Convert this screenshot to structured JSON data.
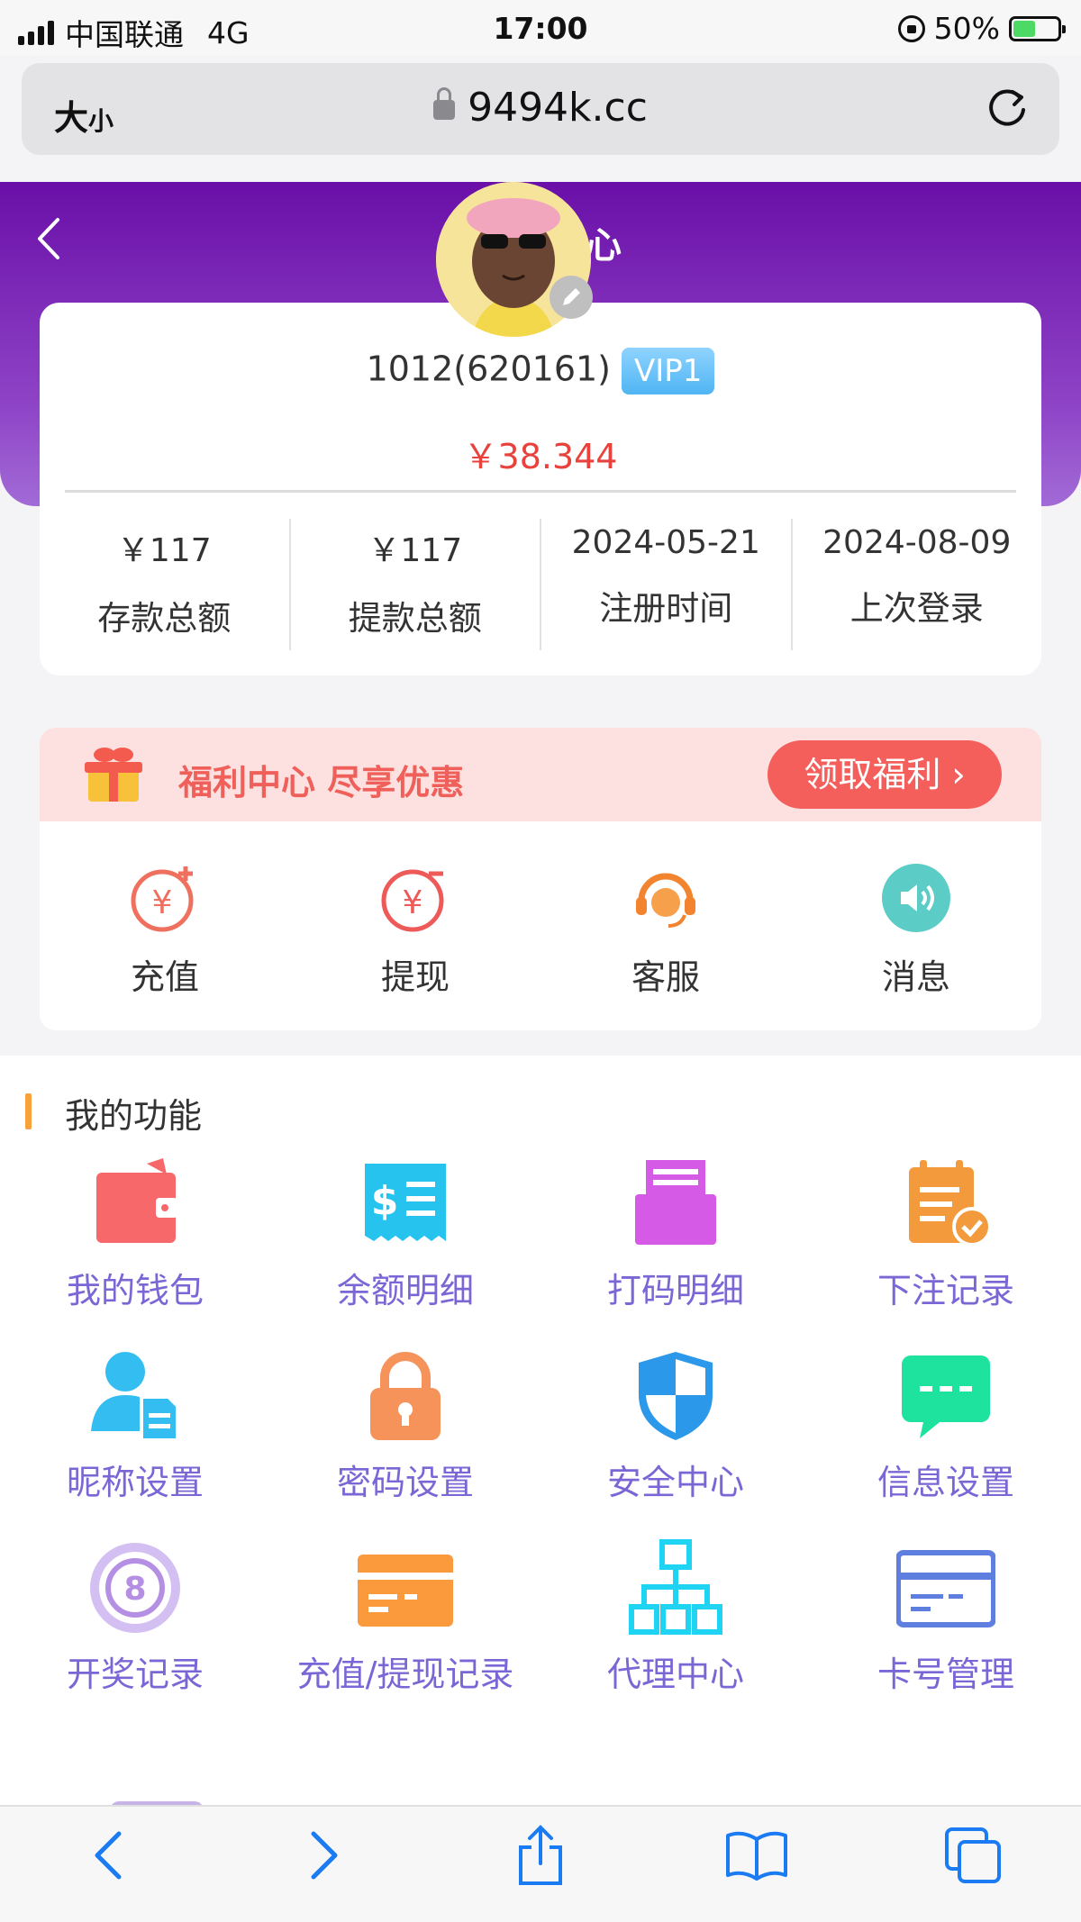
{
  "status_bar": {
    "carrier": "中国联通",
    "network": "4G",
    "time": "17:00",
    "battery": "50%"
  },
  "browser": {
    "text_size": "大",
    "text_size_small": "小",
    "url": "9494k.cc"
  },
  "header": {
    "title_fragment": "心"
  },
  "profile": {
    "username": "1012(620161)",
    "vip": "VIP1",
    "balance": "￥38.344"
  },
  "stats": [
    {
      "value": "￥117",
      "label": "存款总额"
    },
    {
      "value": "￥117",
      "label": "提款总额"
    },
    {
      "value": "2024-05-21",
      "label": "注册时间"
    },
    {
      "value": "2024-08-09",
      "label": "上次登录"
    }
  ],
  "welfare": {
    "text": "福利中心 尽享优惠",
    "button": "领取福利"
  },
  "quick_actions": [
    {
      "label": "充值",
      "icon": "recharge-icon"
    },
    {
      "label": "提现",
      "icon": "withdraw-icon"
    },
    {
      "label": "客服",
      "icon": "customer-service-icon"
    },
    {
      "label": "消息",
      "icon": "message-icon"
    }
  ],
  "functions": {
    "title": "我的功能",
    "items": [
      {
        "label": "我的钱包",
        "icon": "wallet-icon",
        "color": "#f7686b"
      },
      {
        "label": "余额明细",
        "icon": "receipt-icon",
        "color": "#27c3ef"
      },
      {
        "label": "打码明细",
        "icon": "printer-icon",
        "color": "#d55be6"
      },
      {
        "label": "下注记录",
        "icon": "clipboard-check-icon",
        "color": "#f39a3c"
      },
      {
        "label": "昵称设置",
        "icon": "user-doc-icon",
        "color": "#33bdf0"
      },
      {
        "label": "密码设置",
        "icon": "lock-icon",
        "color": "#f5935a"
      },
      {
        "label": "安全中心",
        "icon": "shield-icon",
        "color": "#2b98ea"
      },
      {
        "label": "信息设置",
        "icon": "chat-icon",
        "color": "#1ee39e"
      },
      {
        "label": "开奖记录",
        "icon": "ball-eight-icon",
        "color": "#b58fe3"
      },
      {
        "label": "充值/提现记录",
        "icon": "card-icon",
        "color": "#fa9a3c"
      },
      {
        "label": "代理中心",
        "icon": "org-chart-icon",
        "color": "#1ed4f2"
      },
      {
        "label": "卡号管理",
        "icon": "bank-card-icon",
        "color": "#5f7fe0"
      }
    ]
  }
}
